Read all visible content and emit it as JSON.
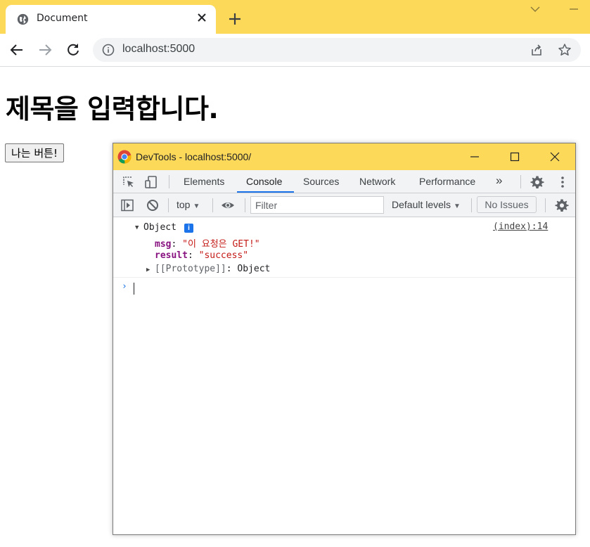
{
  "browser": {
    "tab": {
      "title": "Document",
      "icon": "globe-icon"
    },
    "url": "localhost:5000"
  },
  "page": {
    "heading": "제목을 입력합니다.",
    "button_label": "나는 버튼!"
  },
  "devtools": {
    "window_title": "DevTools - localhost:5000/",
    "tabs": [
      {
        "label": "Elements"
      },
      {
        "label": "Console",
        "active": true
      },
      {
        "label": "Sources"
      },
      {
        "label": "Network"
      },
      {
        "label": "Performance"
      }
    ],
    "more_tabs": "»",
    "console_toolbar": {
      "context": "top",
      "filter_placeholder": "Filter",
      "levels": "Default levels",
      "issues": "No Issues"
    },
    "log": {
      "object_label": "Object",
      "info_badge": "i",
      "source": "(index):14",
      "props": [
        {
          "key": "msg",
          "value": "\"이 요청은 GET!\""
        },
        {
          "key": "result",
          "value": "\"success\""
        }
      ],
      "proto_key": "[[Prototype]]",
      "proto_value": "Object"
    },
    "prompt": "›"
  },
  "colors": {
    "titlebar": "#fdd95a",
    "accent": "#1a73e8",
    "prop_key": "#881280",
    "string": "#c41a16"
  }
}
